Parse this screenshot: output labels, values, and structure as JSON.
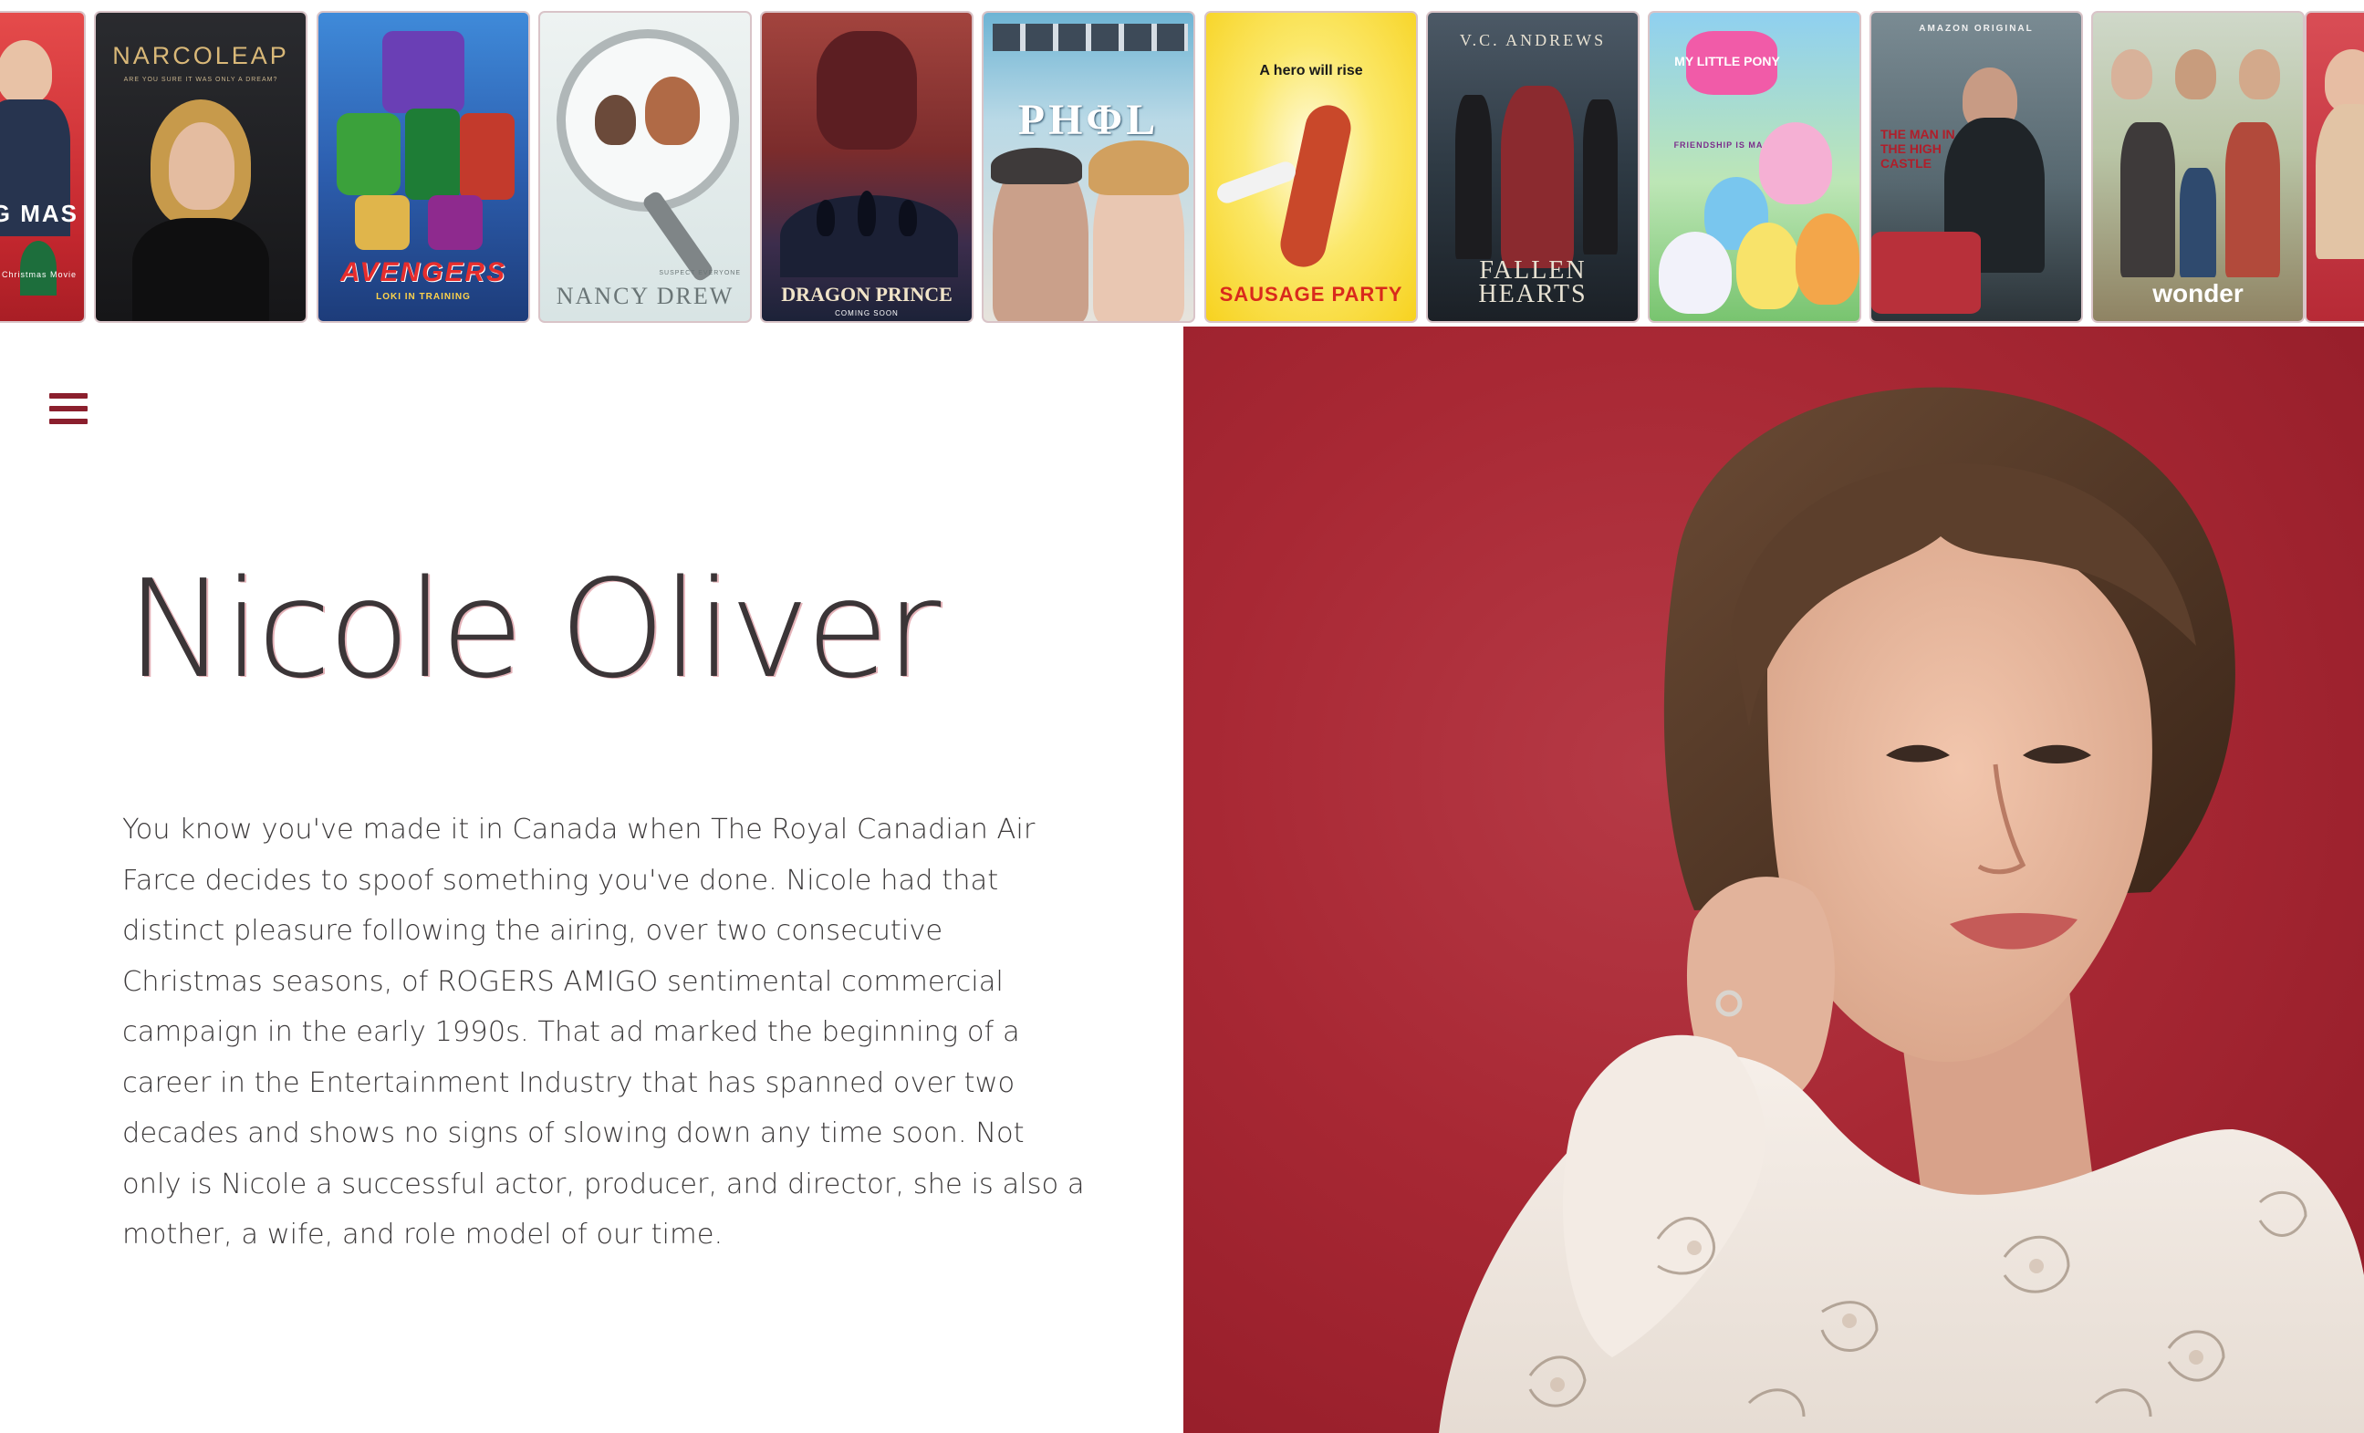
{
  "posters": [
    {
      "id": "poster-christmas",
      "title": "RNING MAS",
      "tag": "A Christmas Movie"
    },
    {
      "id": "poster-narcoleap",
      "title": "NARCOLEAP",
      "tag": "ARE YOU SURE IT WAS ONLY A DREAM?"
    },
    {
      "id": "poster-avengers",
      "title": "AVENGERS",
      "tag": "LOKI IN TRAINING"
    },
    {
      "id": "poster-nancy-drew",
      "title": "NANCY DREW",
      "tag": "SUSPECT EVERYONE"
    },
    {
      "id": "poster-dragon-prince",
      "title": "DRAGON PRINCE",
      "tag": "COMING SOON"
    },
    {
      "id": "poster-phil",
      "title": "PHΦL",
      "tag": ""
    },
    {
      "id": "poster-sausage-party",
      "title": "SAUSAGE PARTY",
      "tag": "A hero will rise"
    },
    {
      "id": "poster-fallen-hearts",
      "title": "FALLEN HEARTS",
      "tag": "V.C. ANDREWS"
    },
    {
      "id": "poster-my-little-pony",
      "title": "MY LITTLE PONY",
      "tag": "FRIENDSHIP IS MAGIC"
    },
    {
      "id": "poster-man-high-castle",
      "title": "THE MAN IN THE HIGH CASTLE",
      "tag": "AMAZON ORIGINAL"
    },
    {
      "id": "poster-wonder",
      "title": "wonder",
      "tag": ""
    }
  ],
  "hero": {
    "name": "Nicole Oliver",
    "bio": "You know you've made it in Canada when The Royal Canadian Air Farce decides to spoof something you've done. Nicole had that distinct pleasure following the airing, over two consecutive Christmas seasons, of ROGERS AMIGO sentimental commercial campaign in the early 1990s. That ad marked the beginning of a career in the Entertainment Industry that has spanned over two decades and shows no signs of slowing down any time soon. Not only is Nicole a successful actor, producer, and director, she is also a mother, a wife, and role model of our time."
  },
  "colors": {
    "accent": "#8b1f2d",
    "portrait_bg": "#a82834",
    "text": "#3d3a3b"
  },
  "icons": {
    "menu": "hamburger-menu-icon"
  }
}
